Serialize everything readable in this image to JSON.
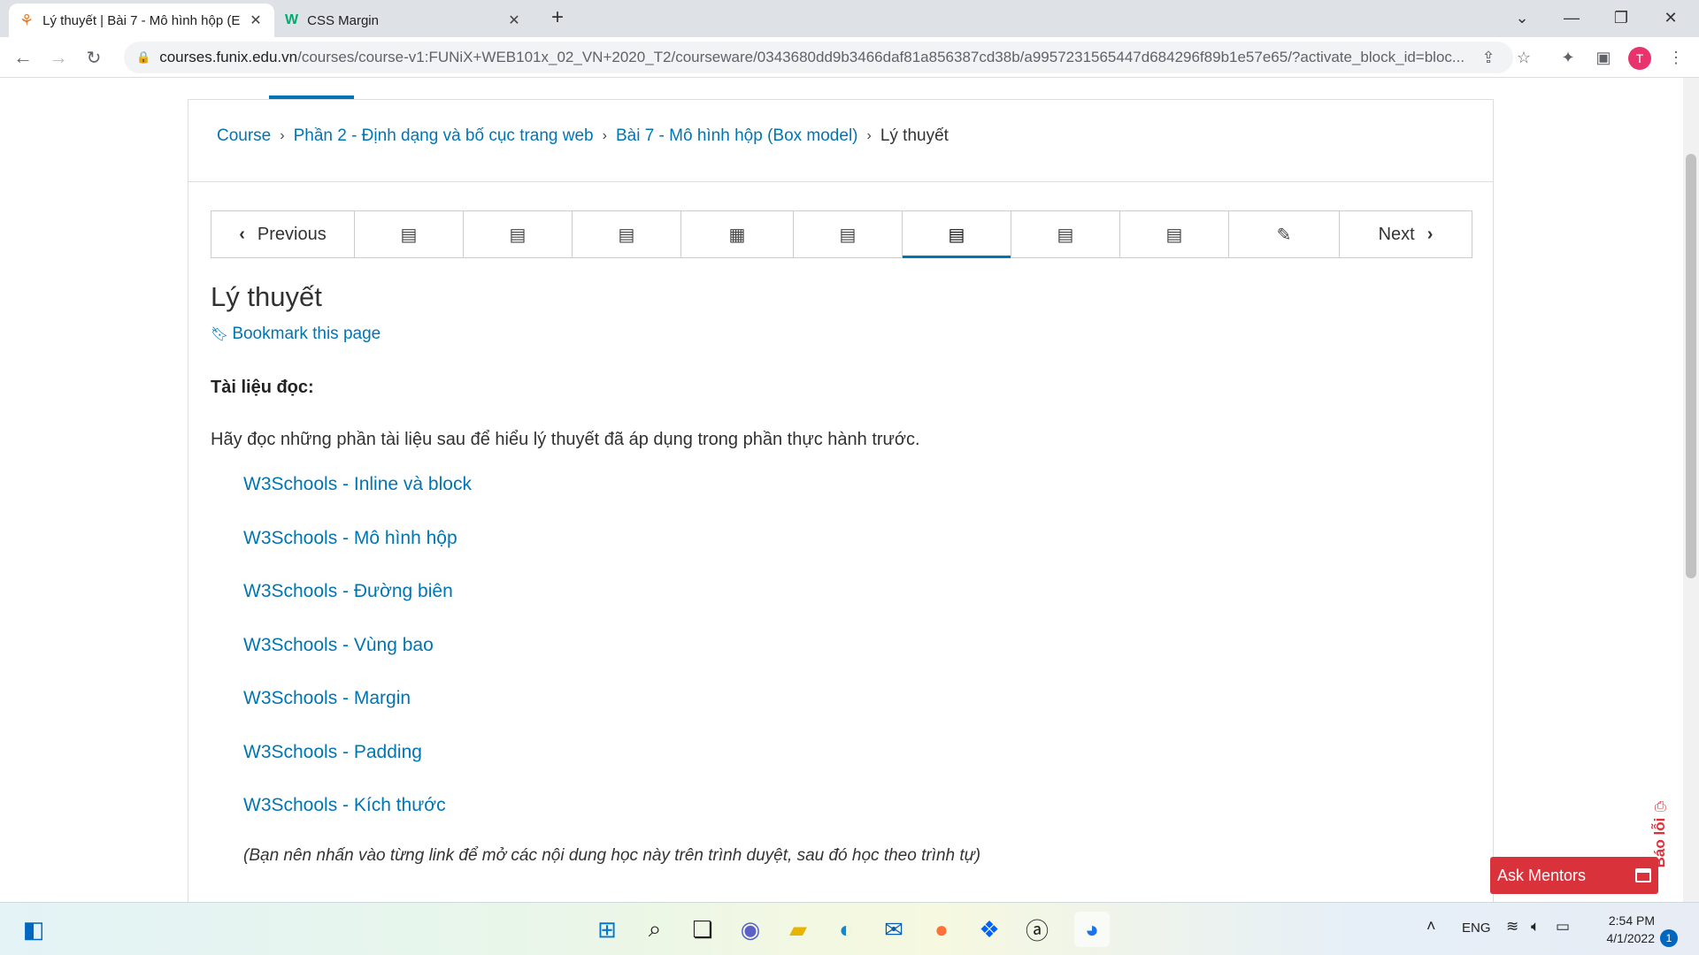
{
  "browser": {
    "tabs": [
      {
        "title": "Lý thuyết | Bài 7 - Mô hình hộp (E",
        "favicon": "funix-icon",
        "active": true
      },
      {
        "title": "CSS Margin",
        "favicon": "w3schools-icon",
        "active": false
      }
    ],
    "new_tab": "+",
    "url_host": "courses.funix.edu.vn",
    "url_path": "/courses/course-v1:FUNiX+WEB101x_02_VN+2020_T2/courseware/0343680dd9b3466daf81a856387cd38b/a9957231565447d684296f89b1e57e65/?activate_block_id=bloc...",
    "avatar_letter": "T"
  },
  "breadcrumb": {
    "items": [
      "Course",
      "Phần 2 - Định dạng và bố cục trang web",
      "Bài 7 - Mô hình hộp (Box model)"
    ],
    "current": "Lý thuyết"
  },
  "seqnav": {
    "previous": "Previous",
    "next": "Next",
    "units": [
      "book-icon",
      "book-icon",
      "book-icon",
      "video-icon",
      "book-icon",
      "book-icon",
      "book-icon",
      "book-icon",
      "edit-icon"
    ],
    "active_index": 5
  },
  "unit": {
    "title": "Lý thuyết",
    "bookmark": "Bookmark this page",
    "doc_heading": "Tài liệu đọc:",
    "intro": "Hãy đọc những phần tài liệu sau để hiểu lý thuyết đã áp dụng trong phần thực hành trước.",
    "links": [
      "W3Schools - Inline và block",
      "W3Schools - Mô hình hộp",
      "W3Schools - Đường biên",
      "W3Schools - Vùng bao",
      "W3Schools - Margin",
      "W3Schools - Padding",
      "W3Schools - Kích thước"
    ],
    "note": "(Bạn nên nhấn vào từng link để mở các nội dung học này trên trình duyệt, sau đó học theo trình tự)"
  },
  "widgets": {
    "report": "Báo lỗi",
    "ask_mentors": "Ask Mentors"
  },
  "taskbar": {
    "lang": "ENG",
    "time": "2:54 PM",
    "date": "4/1/2022",
    "notifications": "1"
  },
  "colors": {
    "link": "#0075b4",
    "accent_red": "#d9323b"
  }
}
